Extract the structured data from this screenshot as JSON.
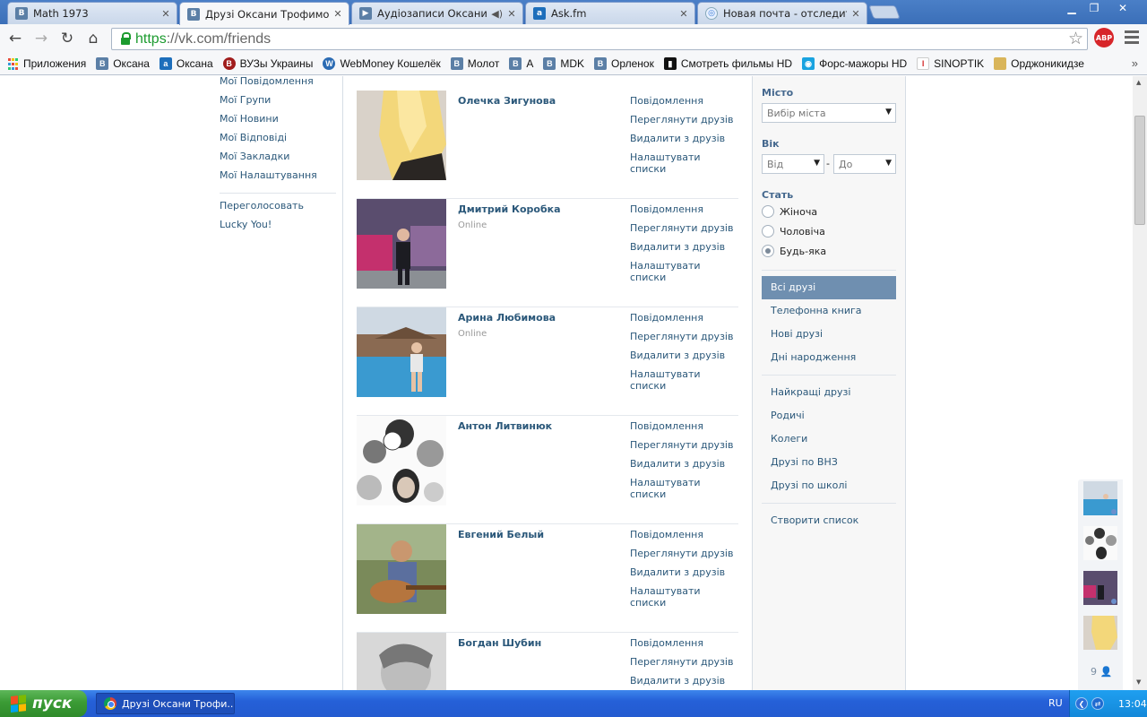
{
  "browser": {
    "tabs": [
      {
        "title": "Math 1973",
        "icon": "vk-icon"
      },
      {
        "title": "Друзі Оксани Трофимової |",
        "icon": "vk-icon"
      },
      {
        "title": "Аудіозаписи Оксани Тро",
        "icon": "audio-icon"
      },
      {
        "title": "Ask.fm",
        "icon": "askfm-icon"
      },
      {
        "title": "Новая почта - отследить п",
        "icon": "mail-icon"
      }
    ],
    "url_scheme": "https",
    "url_rest": "://vk.com/friends",
    "abp_label": "ABP"
  },
  "bookmarks": [
    {
      "label": "Приложения",
      "icon": "apps-icon"
    },
    {
      "label": "Оксана",
      "icon": "vk-icon",
      "glyph": "В"
    },
    {
      "label": "Оксана",
      "icon": "askfm-icon",
      "glyph": "a"
    },
    {
      "label": "ВУЗы Украины",
      "icon": "vuz-icon",
      "glyph": "В"
    },
    {
      "label": "WebMoney Кошелёк",
      "icon": "webmoney-icon",
      "glyph": "W"
    },
    {
      "label": "Молот",
      "icon": "vk-icon",
      "glyph": "В"
    },
    {
      "label": "А",
      "icon": "vk-icon",
      "glyph": "В"
    },
    {
      "label": "MDK",
      "icon": "vk-icon",
      "glyph": "В"
    },
    {
      "label": "Орленок",
      "icon": "vk-icon",
      "glyph": "В"
    },
    {
      "label": "Смотреть фильмы HD",
      "icon": "film-icon",
      "glyph": "▮"
    },
    {
      "label": "Форс-мажоры HD",
      "icon": "fm-icon",
      "glyph": "◉"
    },
    {
      "label": "SINOPTIK",
      "icon": "sinoptik-icon",
      "glyph": "ǀ"
    },
    {
      "label": "Орджоникидзе",
      "icon": "folder-icon",
      "glyph": ""
    }
  ],
  "left_nav": {
    "items": [
      "Мої Повідомлення",
      "Мої Групи",
      "Мої Новини",
      "Мої Відповіді",
      "Мої Закладки",
      "Мої Налаштування"
    ],
    "extra": [
      "Переголосовать",
      "Lucky You!"
    ]
  },
  "friends": [
    {
      "name": "Олечка Зигунова",
      "status": ""
    },
    {
      "name": "Дмитрий Коробка",
      "status": "Online"
    },
    {
      "name": "Арина Любимова",
      "status": "Online"
    },
    {
      "name": "Антон Литвинюк",
      "status": ""
    },
    {
      "name": "Евгений Белый",
      "status": ""
    },
    {
      "name": "Богдан Шубин",
      "status": ""
    }
  ],
  "friend_actions": [
    "Повідомлення",
    "Переглянути друзів",
    "Видалити з друзів",
    "Налаштувати списки"
  ],
  "filters": {
    "city_label": "Місто",
    "city_placeholder": "Вибір міста",
    "age_label": "Вік",
    "age_from": "Від",
    "age_dash": "-",
    "age_to": "До",
    "gender_label": "Стать",
    "genders": [
      "Жіноча",
      "Чоловіча",
      "Будь-яка"
    ],
    "gender_selected": "Будь-яка",
    "lists_primary": [
      "Всі друзі",
      "Телефонна книга",
      "Нові друзі",
      "Дні народження"
    ],
    "lists_secondary": [
      "Найкращі друзі",
      "Родичі",
      "Колеги",
      "Друзі по ВНЗ",
      "Друзі по школі"
    ],
    "create_list": "Створити список"
  },
  "dock": {
    "count": "9"
  },
  "taskbar": {
    "start_label": "пуск",
    "window_title": "Друзі Оксани Трофи...",
    "lang": "RU",
    "time": "13:04"
  },
  "colors": {
    "vk_link": "#2b587a",
    "vk_header": "#45688e",
    "active_list": "#6f8fb0",
    "xp_taskbar": "#245bd0",
    "xp_start": "#3b9b35"
  }
}
